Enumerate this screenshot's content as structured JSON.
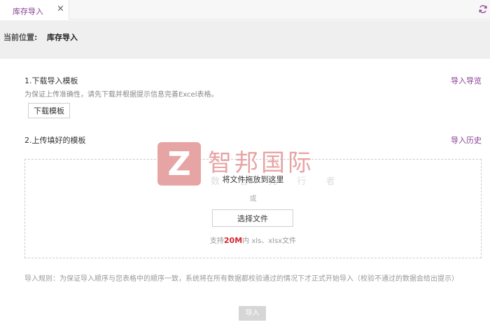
{
  "tabs": [
    {
      "label": "库存导入",
      "close": "×"
    }
  ],
  "location": {
    "label": "当前位置:",
    "value": "库存导入"
  },
  "step1": {
    "title": "1.下载导入模板",
    "hint": "为保证上传准确性，请先下载并根据提示信息完善Excel表格。",
    "download_button": "下载模板",
    "guide_link": "导入导览"
  },
  "step2": {
    "title": "2.上传填好的模板",
    "history_link": "导入历史"
  },
  "upload": {
    "drop_hint": "将文件拖放到这里",
    "or": "或",
    "select_button": "选择文件",
    "support_prefix": "支持",
    "support_size": "20M",
    "support_suffix": "内 xls、xlsx文件"
  },
  "watermark": {
    "logo_letter": "Z",
    "brand": "智邦国际",
    "slogan": "数 智 先 行 者"
  },
  "rules": "导入规则：为保证导入顺序与您表格中的顺序一致，系统将在所有数据都校验通过的情况下才正式开始导入（校验不通过的数据会给出提示）",
  "import_button": "导入",
  "icons": {
    "refresh": "refresh-icon",
    "close": "close-icon"
  },
  "colors": {
    "accent": "#8a3d94",
    "highlight": "#d9232f",
    "watermark": "#e7a4a4"
  }
}
